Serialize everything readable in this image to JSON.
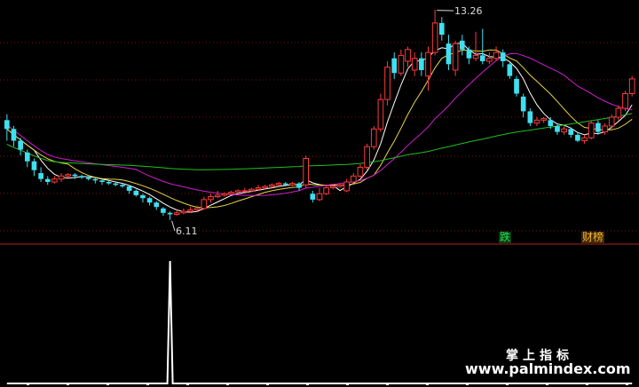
{
  "chart_data": [
    {
      "type": "candlestick",
      "price_labels": {
        "high": "13.26",
        "low": "6.11"
      },
      "markers": [
        {
          "label": "跌",
          "color": "#22e04a"
        },
        {
          "label": "财榜",
          "color": "#f2b632"
        }
      ],
      "ylim": [
        5.5,
        13.4
      ],
      "candles": [
        [
          9.5,
          9.2,
          9.7,
          8.8
        ],
        [
          9.2,
          8.8,
          9.3,
          8.6
        ],
        [
          8.8,
          8.5,
          8.9,
          8.3
        ],
        [
          8.4,
          8.1,
          8.5,
          7.9
        ],
        [
          8.1,
          7.8,
          8.2,
          7.6
        ],
        [
          7.7,
          7.5,
          7.9,
          7.4
        ],
        [
          7.5,
          7.4,
          7.6,
          7.3
        ],
        [
          7.4,
          7.5,
          7.6,
          7.35
        ],
        [
          7.5,
          7.6,
          7.7,
          7.4
        ],
        [
          7.6,
          7.65,
          7.7,
          7.55
        ],
        [
          7.65,
          7.6,
          7.7,
          7.5
        ],
        [
          7.6,
          7.55,
          7.65,
          7.5
        ],
        [
          7.55,
          7.5,
          7.6,
          7.45
        ],
        [
          7.5,
          7.45,
          7.55,
          7.35
        ],
        [
          7.45,
          7.4,
          7.5,
          7.3
        ],
        [
          7.4,
          7.35,
          7.45,
          7.3
        ],
        [
          7.35,
          7.3,
          7.4,
          7.25
        ],
        [
          7.3,
          7.25,
          7.35,
          7.2
        ],
        [
          7.25,
          7.1,
          7.3,
          7.0
        ],
        [
          7.1,
          6.95,
          7.15,
          6.9
        ],
        [
          6.95,
          6.85,
          7.0,
          6.7
        ],
        [
          6.85,
          6.7,
          6.9,
          6.6
        ],
        [
          6.7,
          6.55,
          6.75,
          6.45
        ],
        [
          6.5,
          6.35,
          6.55,
          6.25
        ],
        [
          6.35,
          6.3,
          6.4,
          6.11
        ],
        [
          6.3,
          6.35,
          6.45,
          6.25
        ],
        [
          6.35,
          6.4,
          6.5,
          6.3
        ],
        [
          6.4,
          6.45,
          6.55,
          6.35
        ],
        [
          6.45,
          6.5,
          6.6,
          6.4
        ],
        [
          6.5,
          6.8,
          6.9,
          6.45
        ],
        [
          6.8,
          6.9,
          7.0,
          6.7
        ],
        [
          6.9,
          6.95,
          7.1,
          6.85
        ],
        [
          6.95,
          7.0,
          7.05,
          6.9
        ],
        [
          7.0,
          7.05,
          7.1,
          6.95
        ],
        [
          7.05,
          7.1,
          7.15,
          7.0
        ],
        [
          7.1,
          7.1,
          7.2,
          7.05
        ],
        [
          7.1,
          7.15,
          7.2,
          7.05
        ],
        [
          7.15,
          7.2,
          7.3,
          7.1
        ],
        [
          7.2,
          7.25,
          7.3,
          7.15
        ],
        [
          7.25,
          7.3,
          7.35,
          7.2
        ],
        [
          7.3,
          7.35,
          7.4,
          7.25
        ],
        [
          7.35,
          7.3,
          7.4,
          7.25
        ],
        [
          7.3,
          7.35,
          7.4,
          7.25
        ],
        [
          7.35,
          7.2,
          7.4,
          7.1
        ],
        [
          7.3,
          8.2,
          8.3,
          7.2
        ],
        [
          7.0,
          6.8,
          7.1,
          6.7
        ],
        [
          6.8,
          7.0,
          7.2,
          6.75
        ],
        [
          7.0,
          7.2,
          7.3,
          6.95
        ],
        [
          7.2,
          7.25,
          7.3,
          7.15
        ],
        [
          7.25,
          7.3,
          7.35,
          7.2
        ],
        [
          7.1,
          7.4,
          7.5,
          7.05
        ],
        [
          7.4,
          7.6,
          7.7,
          7.35
        ],
        [
          7.6,
          7.9,
          8.0,
          7.55
        ],
        [
          7.9,
          8.6,
          8.7,
          7.8
        ],
        [
          8.6,
          9.2,
          9.3,
          8.5
        ],
        [
          9.2,
          10.2,
          10.4,
          9.1
        ],
        [
          10.2,
          11.3,
          11.5,
          10.0
        ],
        [
          11.6,
          11.1,
          11.8,
          10.9
        ],
        [
          11.1,
          11.7,
          11.9,
          11.0
        ],
        [
          11.5,
          11.9,
          12.0,
          11.3
        ],
        [
          11.2,
          11.6,
          11.8,
          11.0
        ],
        [
          11.6,
          11.2,
          11.8,
          11.0
        ],
        [
          11.0,
          11.8,
          12.0,
          10.5
        ],
        [
          11.8,
          12.8,
          13.26,
          11.7
        ],
        [
          12.8,
          12.4,
          13.0,
          12.2
        ],
        [
          12.1,
          11.4,
          12.4,
          11.2
        ],
        [
          11.2,
          12.1,
          12.2,
          11.0
        ],
        [
          12.2,
          11.9,
          12.4,
          11.7
        ],
        [
          11.9,
          11.6,
          12.0,
          11.4
        ],
        [
          11.6,
          11.7,
          12.5,
          11.5
        ],
        [
          11.7,
          11.5,
          12.6,
          11.4
        ],
        [
          11.5,
          11.6,
          11.8,
          11.4
        ],
        [
          11.6,
          11.8,
          12.0,
          11.5
        ],
        [
          11.8,
          11.5,
          11.9,
          11.3
        ],
        [
          11.4,
          11.0,
          11.5,
          10.9
        ],
        [
          10.9,
          10.4,
          11.0,
          10.3
        ],
        [
          10.3,
          9.8,
          10.4,
          9.6
        ],
        [
          9.8,
          9.4,
          9.9,
          9.3
        ],
        [
          9.4,
          9.5,
          9.6,
          9.3
        ],
        [
          9.5,
          9.55,
          9.6,
          9.4
        ],
        [
          9.5,
          9.3,
          9.6,
          9.2
        ],
        [
          9.3,
          9.1,
          9.4,
          9.0
        ],
        [
          9.1,
          9.2,
          9.3,
          9.0
        ],
        [
          9.2,
          9.0,
          9.25,
          8.9
        ],
        [
          9.0,
          8.8,
          9.1,
          8.75
        ],
        [
          8.8,
          8.9,
          9.0,
          8.7
        ],
        [
          8.9,
          9.4,
          9.5,
          8.85
        ],
        [
          9.4,
          9.1,
          9.5,
          9.0
        ],
        [
          9.1,
          9.3,
          9.4,
          9.0
        ],
        [
          9.3,
          9.6,
          9.7,
          9.2
        ],
        [
          9.6,
          9.9,
          10.0,
          9.5
        ],
        [
          9.9,
          10.4,
          10.5,
          9.8
        ],
        [
          10.4,
          10.9,
          11.0,
          10.3
        ]
      ],
      "ma_series": [
        {
          "period": 5,
          "color": "#ffffff"
        },
        {
          "period": 10,
          "color": "#e8d44a"
        },
        {
          "period": 20,
          "color": "#d01ecb"
        },
        {
          "period": 60,
          "color": "#20c020"
        }
      ],
      "lower_panel": {
        "type": "spike",
        "values": [
          0,
          0,
          0,
          0,
          0,
          0,
          0,
          0,
          0,
          0,
          0,
          0,
          0,
          0,
          0,
          0,
          0,
          0,
          0,
          0,
          0,
          0,
          0,
          0,
          1,
          0,
          0,
          0,
          0,
          0,
          0,
          0,
          0,
          0,
          0,
          0,
          0,
          0,
          0,
          0,
          0,
          0,
          0,
          0,
          0,
          0,
          0,
          0,
          0,
          0,
          0,
          0,
          0,
          0,
          0,
          0,
          0,
          0,
          0,
          0,
          0,
          0,
          0,
          0,
          0,
          0,
          0,
          0,
          0,
          0,
          0,
          0,
          0,
          0,
          0,
          0,
          0,
          0,
          0,
          0,
          0,
          0,
          0,
          0,
          0,
          0,
          0,
          0,
          0,
          0,
          0,
          0,
          0
        ]
      }
    }
  ],
  "watermark": {
    "title": "掌上指标",
    "url": "www.palmindex.com"
  }
}
